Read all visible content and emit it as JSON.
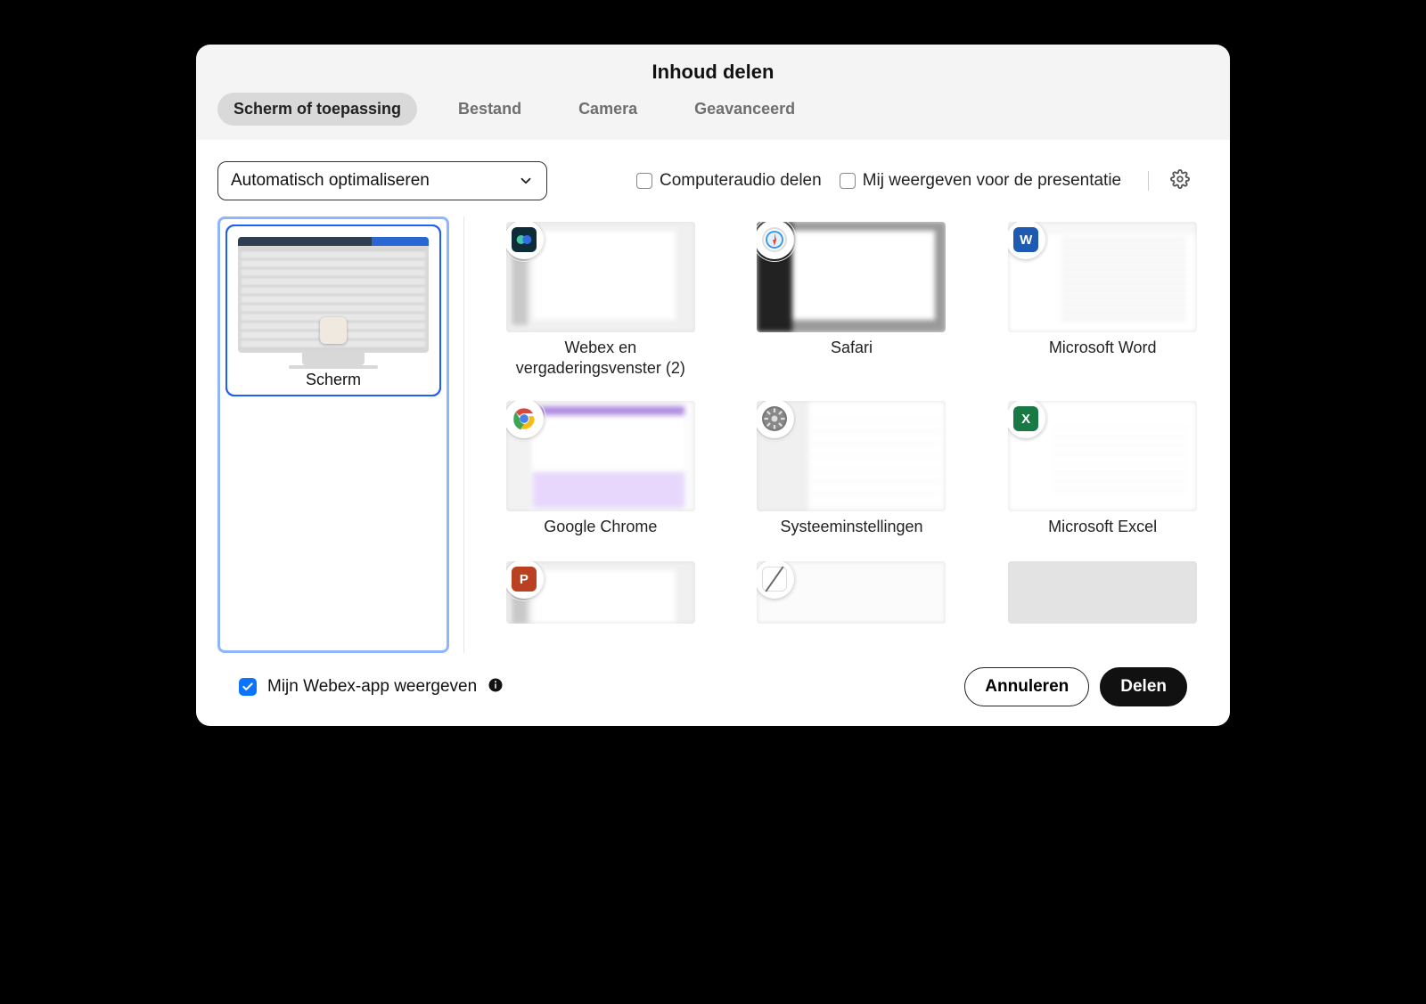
{
  "dialog": {
    "title": "Inhoud delen"
  },
  "tabs": [
    {
      "id": "screen-or-app",
      "label": "Scherm of toepassing",
      "active": true
    },
    {
      "id": "file",
      "label": "Bestand",
      "active": false
    },
    {
      "id": "camera",
      "label": "Camera",
      "active": false
    },
    {
      "id": "advanced",
      "label": "Geavanceerd",
      "active": false
    }
  ],
  "optimize_dropdown": {
    "value": "Automatisch optimaliseren"
  },
  "checkboxes": {
    "share_audio": {
      "label": "Computeraudio delen",
      "checked": false
    },
    "show_me": {
      "label": "Mij weergeven voor de presentatie",
      "checked": false
    }
  },
  "screen_item": {
    "label": "Scherm",
    "selected": true
  },
  "app_items": [
    {
      "id": "webex",
      "label": "Webex en vergaderingsvenster (2)",
      "thumbClass": "",
      "badgeClass": "webex"
    },
    {
      "id": "safari",
      "label": "Safari",
      "thumbClass": "dark",
      "badgeClass": "safari"
    },
    {
      "id": "word",
      "label": "Microsoft Word",
      "thumbClass": "word",
      "badgeClass": "word",
      "letter": "W"
    },
    {
      "id": "chrome",
      "label": "Google Chrome",
      "thumbClass": "purple",
      "badgeClass": "chrome"
    },
    {
      "id": "sysprefs",
      "label": "Systeeminstellingen",
      "thumbClass": "light",
      "badgeClass": "sys"
    },
    {
      "id": "excel",
      "label": "Microsoft Excel",
      "thumbClass": "plain",
      "badgeClass": "excel",
      "letter": "X"
    },
    {
      "id": "powerpoint",
      "label": "",
      "thumbClass": "row3",
      "badgeClass": "ppt",
      "letter": "P"
    },
    {
      "id": "textedit",
      "label": "",
      "thumbClass": "textedit row3",
      "badgeClass": "textedit"
    },
    {
      "id": "other",
      "label": "",
      "thumbClass": "empty row3",
      "badgeClass": "empty"
    }
  ],
  "footer": {
    "show_webex_app": {
      "label": "Mijn Webex-app weergeven",
      "checked": true
    },
    "cancel": "Annuleren",
    "share": "Delen"
  },
  "icon_names": {
    "gear": "gear-icon",
    "info": "info-icon",
    "chevron": "chevron-down-icon",
    "check": "checkmark-icon"
  }
}
